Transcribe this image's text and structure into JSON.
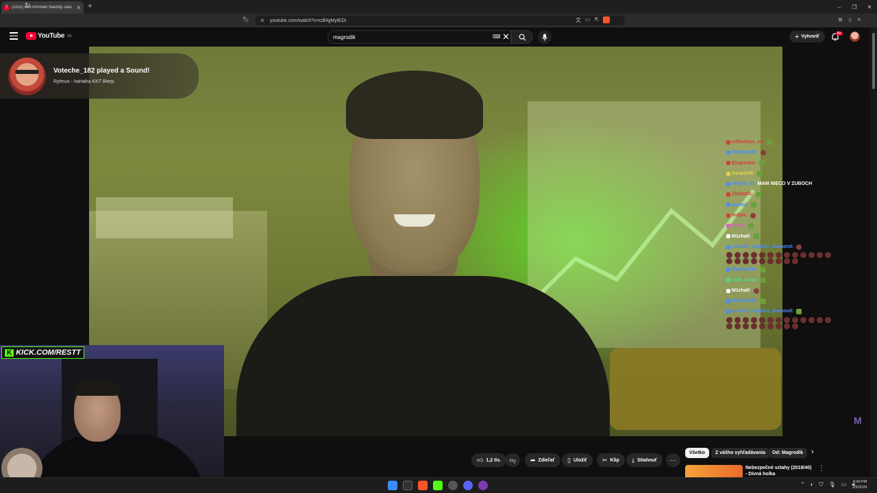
{
  "browser": {
    "tab_title": "(1102) Ako PPPeter Navždy Zeni",
    "new_tab": "+",
    "url": "youtube.com/watch?v=cdl4gMyIEDI"
  },
  "youtube": {
    "logo_text": "YouTube",
    "logo_region": "SK",
    "search_value": "magrodik",
    "create_label": "Vytvoriť",
    "notifications_count": "9+"
  },
  "alert": {
    "title": "Voteche_182 played a Sound!",
    "subtitle": "Rytmus - haHaha KKT Bierp"
  },
  "kick": {
    "logo_letter": "K",
    "label": "KICK.COM/RESTT"
  },
  "chat": {
    "messages": [
      {
        "user": "erfanebus_cw",
        "color": "#d83a3a",
        "text": ""
      },
      {
        "user": "Ragequ1tz:",
        "color": "#4a8cff",
        "text": ""
      },
      {
        "user": "Elegrenko:",
        "color": "#d83a3a",
        "text": ""
      },
      {
        "user": "Gaspi249:",
        "color": "#e6d34a",
        "text": ""
      },
      {
        "user": "kNight_53:",
        "color": "#4a8cff",
        "text": "MAM NIECO V ZUBOCH"
      },
      {
        "user": "Zlatito01:",
        "color": "#d83a3a",
        "text": ""
      },
      {
        "user": "wamat:",
        "color": "#4a8cff",
        "text": ""
      },
      {
        "user": "xofjax:",
        "color": "#d83a3a",
        "text": ""
      },
      {
        "user": "sl4yy:",
        "color": "#e25ad0",
        "text": ""
      },
      {
        "user": "M1chall:",
        "color": "#ffffff",
        "text": ""
      },
      {
        "user": "sanelko_nigaldo_diamond:",
        "color": "#4a8cff",
        "text": ""
      },
      {
        "user": "Ragequ1tz:",
        "color": "#4a8cff",
        "text": ""
      },
      {
        "user": "2AM_kuba:",
        "color": "#4adc8a",
        "text": ""
      },
      {
        "user": "M1chall:",
        "color": "#ffffff",
        "text": ""
      },
      {
        "user": "Bauchovic:",
        "color": "#4a8cff",
        "text": ""
      },
      {
        "user": "sanelko_nigaldo_diamond:",
        "color": "#4a8cff",
        "text": ""
      }
    ]
  },
  "actions": {
    "likes": "1,2 tis.",
    "share": "Zdieľať",
    "save": "Uložiť",
    "clip": "Klip",
    "download": "Stiahnuť"
  },
  "filters": [
    "Všetko",
    "Z vášho vyhľadávania",
    "Od: Magrodik"
  ],
  "recommendation": {
    "title": "Nebezpečné vztahy (2019/40) - Dívná holka"
  },
  "taskbar": {
    "time": "8:49 PM",
    "date": "2/5/2026"
  },
  "colors": {
    "youtube_red": "#ff0033",
    "kick_green": "#53fc18"
  }
}
